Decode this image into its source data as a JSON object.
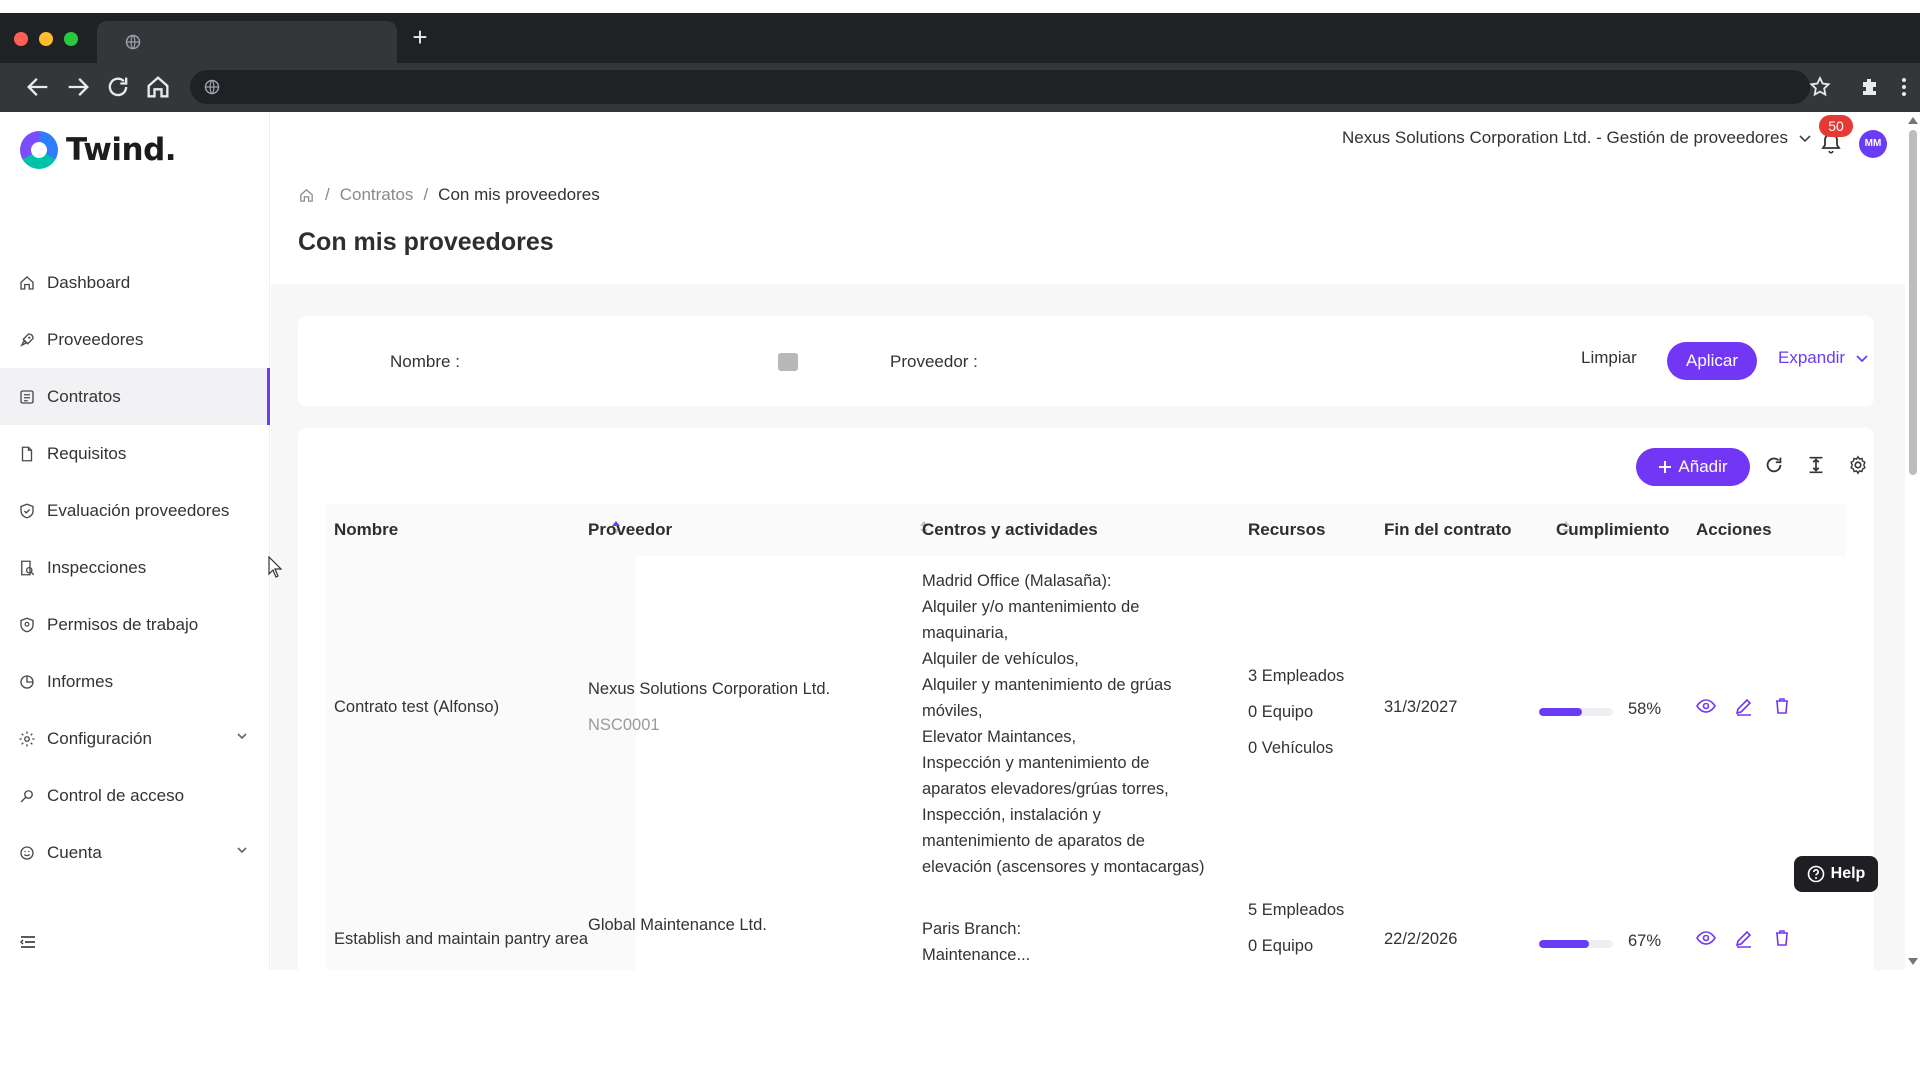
{
  "sidebar": {
    "logo_text": "Twind.",
    "items": [
      {
        "label": "Dashboard"
      },
      {
        "label": "Proveedores"
      },
      {
        "label": "Contratos"
      },
      {
        "label": "Requisitos"
      },
      {
        "label": "Evaluación proveedores"
      },
      {
        "label": "Inspecciones"
      },
      {
        "label": "Permisos de trabajo"
      },
      {
        "label": "Informes"
      },
      {
        "label": "Configuración"
      },
      {
        "label": "Control de acceso"
      },
      {
        "label": "Cuenta"
      }
    ],
    "active_item": "Contratos"
  },
  "header": {
    "org_selector": "Nexus Solutions Corporation Ltd. - Gestión de proveedores",
    "notification_count": "50",
    "avatar_initials": "MM"
  },
  "breadcrumb": {
    "level1": "Contratos",
    "current": "Con mis proveedores"
  },
  "page_title": "Con mis proveedores",
  "filters": {
    "nombre_label": "Nombre",
    "nombre_value": "",
    "proveedor_label": "Proveedor",
    "proveedor_value": "",
    "clear_label": "Limpiar",
    "apply_label": "Aplicar",
    "expand_label": "Expandir"
  },
  "table": {
    "add_label": "Añadir",
    "columns": {
      "nombre": "Nombre",
      "proveedor": "Proveedor",
      "centros": "Centros y actividades",
      "recursos": "Recursos",
      "fin": "Fin del contrato",
      "cumplimiento": "Cumplimiento",
      "acciones": "Acciones"
    },
    "rows": [
      {
        "nombre": "Contrato test (Alfonso)",
        "proveedor": "Nexus Solutions Corporation Ltd.",
        "proveedor_code": "NSC0001",
        "centros": [
          "Madrid Office (Malasaña):",
          "Alquiler y/o mantenimiento de",
          "maquinaria,",
          "Alquiler de vehículos,",
          "Alquiler y mantenimiento de grúas",
          "móviles,",
          "Elevator Maintances,",
          "Inspección y mantenimiento de",
          "aparatos elevadores/grúas torres,",
          "Inspección, instalación y",
          "mantenimiento de aparatos de",
          "elevación (ascensores y montacargas)"
        ],
        "recursos": [
          "3 Empleados",
          "0 Equipo",
          "0 Vehículos"
        ],
        "fin": "31/3/2027",
        "cumplimiento_pct": 58,
        "cumplimiento_label": "58%"
      },
      {
        "nombre": "Establish and maintain pantry area",
        "proveedor": "Global Maintenance Ltd.",
        "proveedor_code": "",
        "centros": [
          "Paris Branch:",
          "Maintenance..."
        ],
        "recursos": [
          "5 Empleados",
          "0 Equipo"
        ],
        "fin": "22/2/2026",
        "cumplimiento_pct": 67,
        "cumplimiento_label": "67%"
      }
    ]
  },
  "help_label": "Help",
  "colors": {
    "accent": "#7236f5",
    "badge": "#e53935"
  }
}
